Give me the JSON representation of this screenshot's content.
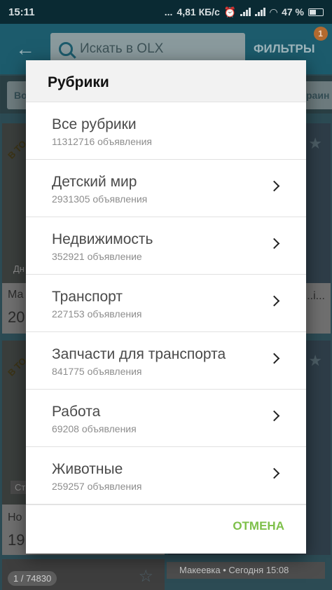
{
  "status_bar": {
    "time": "15:11",
    "dots": "...",
    "speed": "4,81 КБ/с",
    "battery": "47 %"
  },
  "app_bar": {
    "search_placeholder": "Искать в OLX",
    "filters_label": "ФИЛЬТРЫ",
    "filters_badge": "1"
  },
  "background": {
    "chip_left": "Во",
    "chip_right": "краин",
    "card1_corner": "В ТО",
    "card1_date": "Дн",
    "card1_title": "Ма",
    "card1_price": "20",
    "card2_corner": "В ТО",
    "card2_tag": "Ст",
    "card2_title": "Но",
    "card2_price": "19",
    "card_right_title": "...i...",
    "counter": "1 / 74830",
    "footer_location": "Макеевка • Сегодня 15:08"
  },
  "dialog": {
    "title": "Рубрики",
    "cancel_label": "ОТМЕНА",
    "categories": [
      {
        "name": "Все рубрики",
        "count": "11312716 объявления",
        "has_arrow": false
      },
      {
        "name": "Детский мир",
        "count": "2931305 объявления",
        "has_arrow": true
      },
      {
        "name": "Недвижимость",
        "count": "352921 объявление",
        "has_arrow": true
      },
      {
        "name": "Транспорт",
        "count": "227153 объявления",
        "has_arrow": true
      },
      {
        "name": "Запчасти для транспорта",
        "count": "841775 объявления",
        "has_arrow": true
      },
      {
        "name": "Работа",
        "count": "69208 объявления",
        "has_arrow": true
      },
      {
        "name": "Животные",
        "count": "259257 объявления",
        "has_arrow": true
      }
    ],
    "accent_color": "#7ec04a"
  }
}
